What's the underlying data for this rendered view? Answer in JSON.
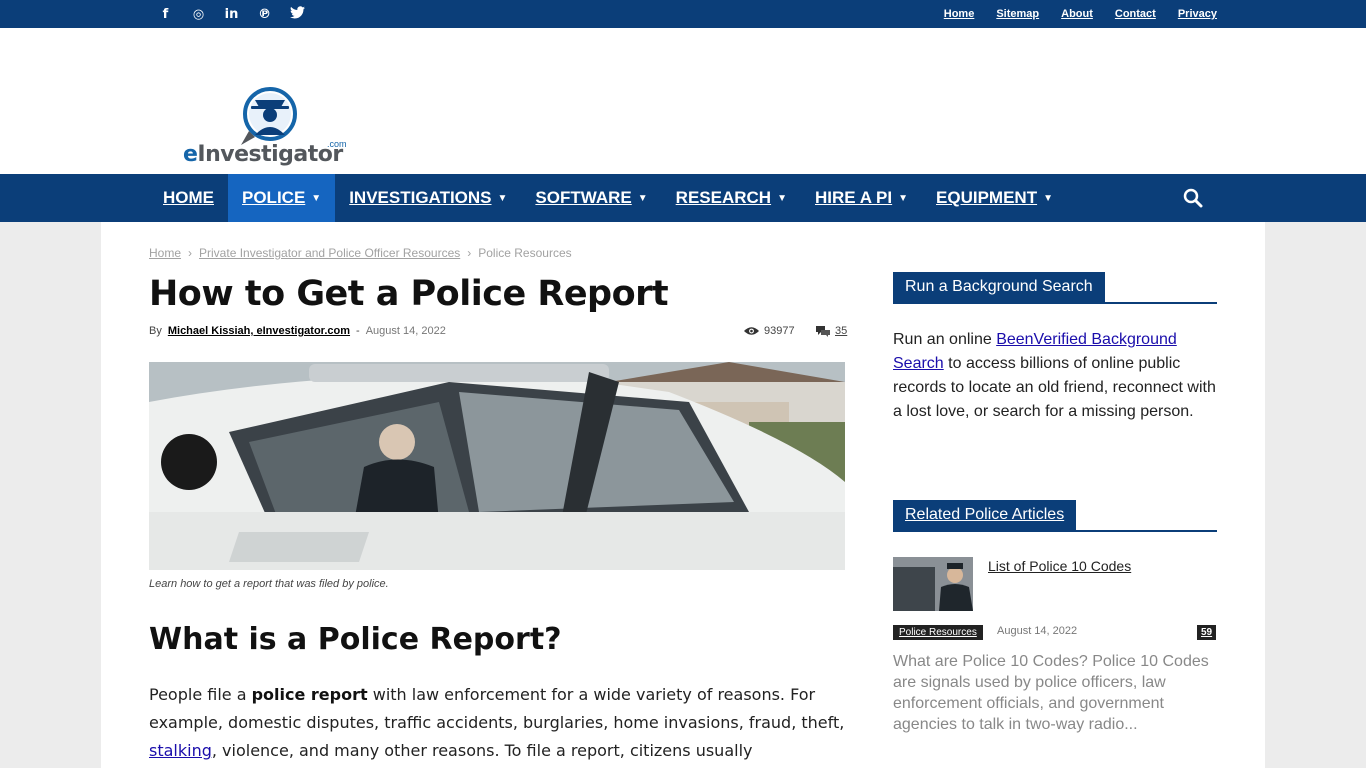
{
  "social": {
    "icons": [
      "facebook-icon",
      "instagram-icon",
      "linkedin-icon",
      "pinterest-icon",
      "twitter-icon"
    ],
    "glyphs": [
      "f",
      "◎",
      "in",
      "℗",
      "🐦"
    ]
  },
  "toplinks": [
    "Home",
    "Sitemap",
    "About",
    "Contact",
    "Privacy"
  ],
  "logo": {
    "prefix": "e",
    "name": "Investigator",
    "suffix": ".com"
  },
  "nav": {
    "items": [
      {
        "label": "HOME",
        "dropdown": false
      },
      {
        "label": "POLICE",
        "dropdown": true,
        "active": true
      },
      {
        "label": "INVESTIGATIONS",
        "dropdown": true
      },
      {
        "label": "SOFTWARE",
        "dropdown": true
      },
      {
        "label": "RESEARCH",
        "dropdown": true
      },
      {
        "label": "HIRE A PI",
        "dropdown": true
      },
      {
        "label": "EQUIPMENT",
        "dropdown": true
      }
    ]
  },
  "breadcrumb": {
    "items": [
      "Home",
      "Private Investigator and Police Officer Resources",
      "Police Resources"
    ],
    "sep": "›"
  },
  "article": {
    "title": "How to Get a Police Report",
    "by": "By",
    "author": "Michael Kissiah, eInvestigator.com",
    "dash": "-",
    "date": "August 14, 2022",
    "views": "93977",
    "comments": "35",
    "caption": "Learn how to get a report that was filed by police.",
    "h2": "What is a Police Report?",
    "p1_a": "People file a ",
    "p1_bold": "police report",
    "p1_b": " with law enforcement for a wide variety of reasons. For example, domestic disputes, traffic accidents, burglaries, home invasions, fraud, theft, ",
    "p1_link": "stalking",
    "p1_c": ", violence, and many other reasons. To file a report, citizens usually"
  },
  "sidebar": {
    "bg_title": "Run a Background Search",
    "bg_a": "Run an online ",
    "bg_link": "BeenVerified Background Search",
    "bg_b": " to access billions of online public records to locate an old friend, reconnect with a lost love, or search for a missing person.",
    "related_title": "Related Police Articles",
    "related": {
      "title": "List of Police 10 Codes",
      "category": "Police Resources",
      "date": "August 14, 2022",
      "count": "59",
      "excerpt": "What are Police 10 Codes? Police 10 Codes are signals used by police officers, law enforcement officials, and government agencies to talk in two-way radio..."
    }
  },
  "colors": {
    "brand": "#0b3e79",
    "active": "#1565c0",
    "link": "#1a0dab"
  }
}
